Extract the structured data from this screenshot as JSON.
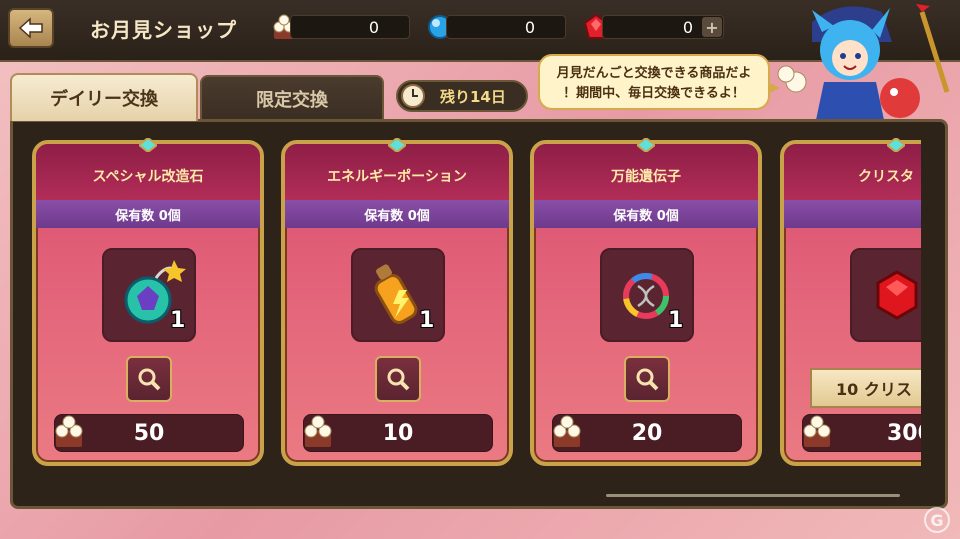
{
  "header": {
    "back_icon": "back-arrow-icon",
    "title": "お月見ショップ",
    "currencies": [
      {
        "name": "dango",
        "icon": "dango-icon",
        "value": "0"
      },
      {
        "name": "blue-orb",
        "icon": "blue-orb-icon",
        "value": "0"
      },
      {
        "name": "red-gem",
        "icon": "red-gem-icon",
        "value": "0"
      }
    ],
    "add_icon": "plus-icon"
  },
  "tabs": [
    {
      "label": "デイリー交換",
      "active": true
    },
    {
      "label": "限定交換",
      "active": false
    }
  ],
  "timer": {
    "icon": "clock-icon",
    "label": "残り14日"
  },
  "speech": {
    "line1": "月見だんごと交換できる商品だよ",
    "line2": "！期間中、毎日交換できるよ！"
  },
  "cards": [
    {
      "name": "スペシャル改造石",
      "owned": "保有数 0個",
      "qty": "1",
      "price": "50",
      "item_icon": "special-stone-icon"
    },
    {
      "name": "エネルギーポーション",
      "owned": "保有数 0個",
      "qty": "1",
      "price": "10",
      "item_icon": "energy-potion-icon"
    },
    {
      "name": "万能遺伝子",
      "owned": "保有数 0個",
      "qty": "1",
      "price": "20",
      "item_icon": "universal-gene-icon"
    },
    {
      "name": "クリスタ",
      "owned": "",
      "qty": "",
      "price": "300",
      "craft": "10 クリス",
      "item_icon": "red-crystal-icon"
    }
  ],
  "colors": {
    "card_top": "#d94d6e",
    "header_bar": "#2a2119",
    "gold_border": "#c9a24a",
    "owned_bar": "#8a4ea8"
  },
  "watermark": "G"
}
